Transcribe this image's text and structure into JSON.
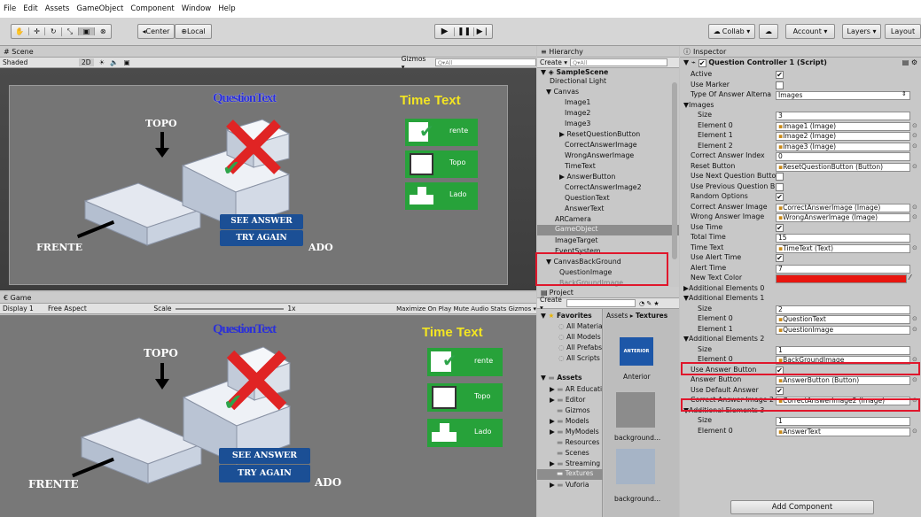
{
  "menu": [
    "File",
    "Edit",
    "Assets",
    "GameObject",
    "Component",
    "Window",
    "Help"
  ],
  "toolbar": {
    "center_label": "◂Center",
    "local_label": "⊕Local",
    "collab_label": "Collab ▾",
    "account_label": "Account ▾",
    "layers_label": "Layers ▾",
    "layout_label": "Layout"
  },
  "scene": {
    "tab": "# Scene",
    "shaded": "Shaded",
    "mode_2d": "2D",
    "gizmos": "Gizmos ▾",
    "search_placeholder": "Q▾All"
  },
  "game": {
    "tab": "€ Game",
    "display": "Display 1",
    "aspect": "Free Aspect",
    "scale_label": "Scale",
    "scale_value": "1x",
    "buttons": "Maximize On Play  Mute Audio  Stats  Gizmos ▾"
  },
  "canvas_content": {
    "question_text": "QuestionText",
    "time_text": "Time Text",
    "topo": "TOPO",
    "frente": "FRENTE",
    "lado_partial": "ADO",
    "see_answer": "SEE ANSWER",
    "try_again": "TRY AGAIN",
    "card_frente": "rente",
    "card_topo": "Topo",
    "card_lado": "Lado",
    "accent_green": "#27a23a",
    "accent_blue": "#1b4f95",
    "accent_yellow": "#f3e522",
    "accent_red": "#e02424"
  },
  "hierarchy": {
    "tab": "≡ Hierarchy",
    "create": "Create ▾",
    "search": "Q▾All",
    "scene_name": "SampleScene",
    "items": [
      "Directional Light",
      "Canvas",
      "Image1",
      "Image2",
      "Image3",
      "ResetQuestionButton",
      "CorrectAnswerImage",
      "WrongAnswerImage",
      "TimeText",
      "AnswerButton",
      "CorrectAnswerImage2",
      "QuestionText",
      "AnswerText",
      "ARCamera",
      "GameObject",
      "ImageTarget",
      "EventSystem",
      "CanvasBackGround",
      "QuestionImage",
      "BackGroundImage"
    ]
  },
  "project": {
    "tab": "Project",
    "create": "Create ▾",
    "favorites_label": "Favorites",
    "favorites": [
      "All Materia",
      "All Models",
      "All Prefabs",
      "All Scripts"
    ],
    "assets_label": "Assets",
    "assets": [
      "AR Educati",
      "Editor",
      "Gizmos",
      "Models",
      "MyModels",
      "Resources",
      "Scenes",
      "Streaming",
      "Textures",
      "Vuforia"
    ],
    "breadcrumb_root": "Assets",
    "breadcrumb_leaf": "Textures",
    "thumbs": [
      "Anterior",
      "background...",
      "background..."
    ],
    "anterior_badge": "ANTERIOR"
  },
  "inspector": {
    "tab": "Inspector",
    "component_title": "Question Controller 1 (Script)",
    "add_component": "Add Component",
    "rows": [
      {
        "label": "Active",
        "kind": "check",
        "value": "✔"
      },
      {
        "label": "Use Marker",
        "kind": "check",
        "value": ""
      },
      {
        "label": "Type Of Answer Alterna",
        "kind": "select",
        "value": "Images"
      },
      {
        "label": "▼Images",
        "kind": "none",
        "value": ""
      },
      {
        "label": "Size",
        "kind": "text",
        "value": "3"
      },
      {
        "label": "Element 0",
        "kind": "obj",
        "value": "Image1 (Image)"
      },
      {
        "label": "Element 1",
        "kind": "obj",
        "value": "Image2 (Image)"
      },
      {
        "label": "Element 2",
        "kind": "obj",
        "value": "Image3 (Image)"
      },
      {
        "label": "Correct Answer Index",
        "kind": "text",
        "value": "0"
      },
      {
        "label": "Reset Button",
        "kind": "obj",
        "value": "ResetQuestionButton (Button)"
      },
      {
        "label": "Use Next Question Butto",
        "kind": "check",
        "value": ""
      },
      {
        "label": "Use Previous Question B",
        "kind": "check",
        "value": ""
      },
      {
        "label": "Random Options",
        "kind": "check",
        "value": "✔"
      },
      {
        "label": "Correct Answer Image",
        "kind": "obj",
        "value": "CorrectAnswerImage (Image)"
      },
      {
        "label": "Wrong Answer Image",
        "kind": "obj",
        "value": "WrongAnswerImage (Image)"
      },
      {
        "label": "Use Time",
        "kind": "check",
        "value": "✔"
      },
      {
        "label": "Total Time",
        "kind": "text",
        "value": "15"
      },
      {
        "label": "Time Text",
        "kind": "obj",
        "value": "TimeText (Text)"
      },
      {
        "label": "Use Alert Time",
        "kind": "check",
        "value": "✔"
      },
      {
        "label": "Alert Time",
        "kind": "text",
        "value": "7"
      },
      {
        "label": "New Text Color",
        "kind": "color",
        "value": ""
      },
      {
        "label": "▶Additional Elements 0",
        "kind": "none",
        "value": ""
      },
      {
        "label": "▼Additional Elements 1",
        "kind": "none",
        "value": ""
      },
      {
        "label": "Size",
        "kind": "text",
        "value": "2"
      },
      {
        "label": "Element 0",
        "kind": "obj",
        "value": "QuestionText"
      },
      {
        "label": "Element 1",
        "kind": "obj",
        "value": "QuestionImage"
      },
      {
        "label": "▼Additional Elements 2",
        "kind": "none",
        "value": ""
      },
      {
        "label": "Size",
        "kind": "text",
        "value": "1"
      },
      {
        "label": "Element 0",
        "kind": "obj",
        "value": "BackGroundImage"
      },
      {
        "label": "Use Answer Button",
        "kind": "check",
        "value": "✔"
      },
      {
        "label": "Answer Button",
        "kind": "obj",
        "value": "AnswerButton (Button)"
      },
      {
        "label": "Use Default Answer",
        "kind": "check",
        "value": "✔"
      },
      {
        "label": "Correct Answer Image 2",
        "kind": "obj",
        "value": "CorrectAnswerImage2 (Image)"
      },
      {
        "label": "▼Additional Elements 3",
        "kind": "none",
        "value": ""
      },
      {
        "label": "Size",
        "kind": "text",
        "value": "1"
      },
      {
        "label": "Element 0",
        "kind": "obj",
        "value": "AnswerText"
      }
    ],
    "new_text_color": "#e8160f"
  }
}
